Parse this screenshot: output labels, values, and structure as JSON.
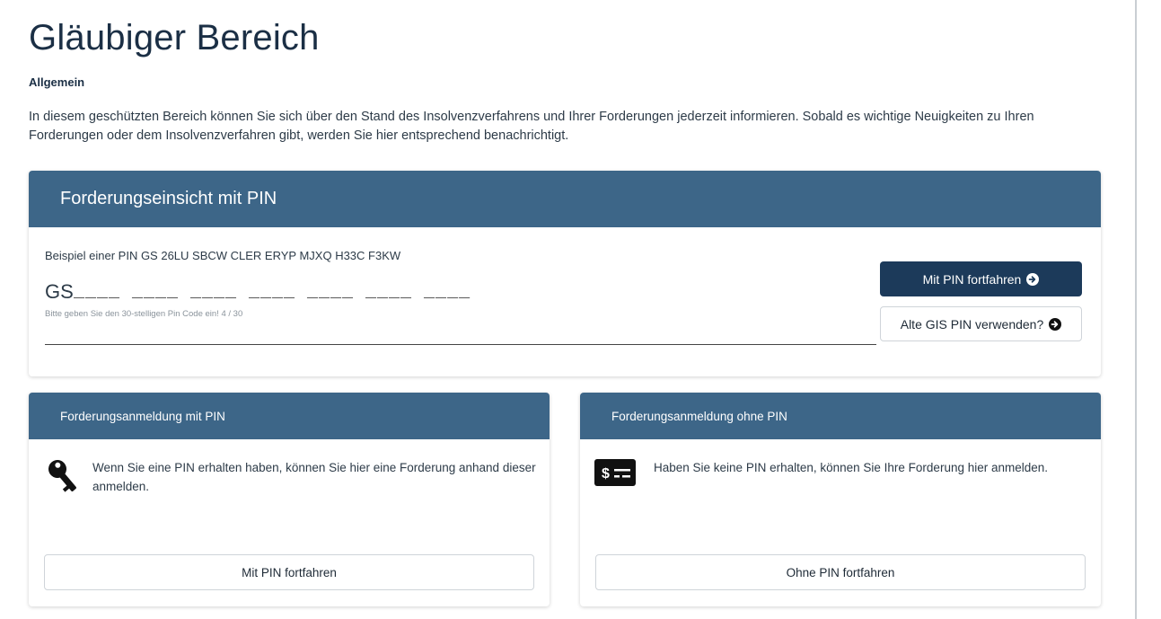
{
  "page": {
    "title": "Gläubiger Bereich",
    "section_label": "Allgemein",
    "intro": "In diesem geschützten Bereich können Sie sich über den Stand des Insolvenzverfahrens und Ihrer Forderungen jederzeit informieren. Sobald es wichtige Neuigkeiten zu Ihren Forderungen oder dem Insolvenzverfahren gibt, werden Sie hier entsprechend benachrichtigt."
  },
  "pin_card": {
    "title": "Forderungseinsicht mit PIN",
    "example": "Beispiel einer PIN GS 26LU SBCW CLER ERYP MJXQ H33C F3KW",
    "prefix": "GS",
    "input_value": "____ ____ ____ ____ ____ ____ ____",
    "hint": "Bitte geben Sie den 30-stelligen Pin Code ein! 4 / 30",
    "primary_button": "Mit PIN fortfahren",
    "secondary_button": "Alte GIS PIN verwenden?",
    "button_icon": "circle-arrow-right-icon"
  },
  "card_with_pin": {
    "title": "Forderungsanmeldung mit PIN",
    "text": "Wenn Sie eine PIN erhalten haben, können Sie hier eine Forderung anhand dieser anmelden.",
    "icon": "key-icon",
    "button": "Mit PIN fortfahren"
  },
  "card_without_pin": {
    "title": "Forderungsanmeldung ohne PIN",
    "text": "Haben Sie keine PIN erhalten, können Sie Ihre Forderung hier anmelden.",
    "icon": "money-bill-icon",
    "icon_text": "$",
    "button": "Ohne PIN fortfahren"
  },
  "colors": {
    "header_bg": "#3d6688",
    "primary_button": "#1c3a5a",
    "title_text": "#1b2f45"
  }
}
